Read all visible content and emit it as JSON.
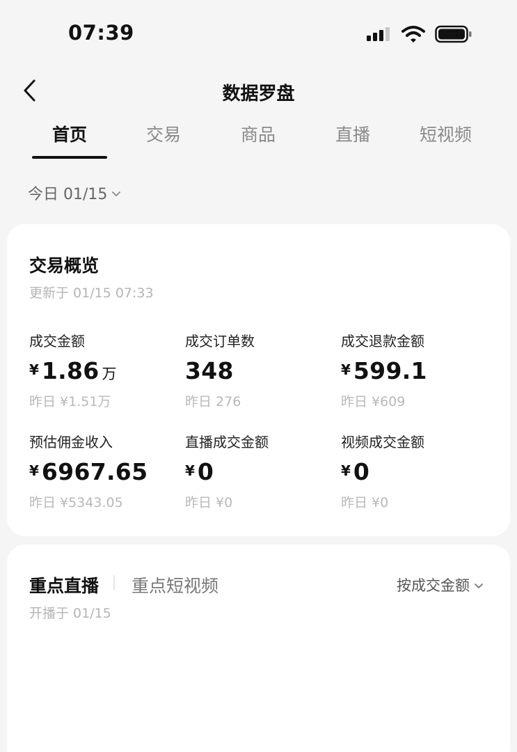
{
  "status_bar": {
    "time": "07:39",
    "icons": [
      "signal-icon",
      "wifi-icon",
      "battery-icon"
    ]
  },
  "nav": {
    "title": "数据罗盘",
    "back_icon": "chevron-left-icon"
  },
  "tabs": [
    {
      "label": "首页",
      "active": true
    },
    {
      "label": "交易",
      "active": false
    },
    {
      "label": "商品",
      "active": false
    },
    {
      "label": "直播",
      "active": false
    },
    {
      "label": "短视频",
      "active": false
    }
  ],
  "date_filter": {
    "label": "今日 01/15",
    "icon": "chevron-down-icon"
  },
  "overview": {
    "title": "交易概览",
    "updated": "更新于 01/15 07:33",
    "metrics": [
      {
        "label": "成交金额",
        "currency": "¥",
        "value": "1.86",
        "unit": "万",
        "previous": "昨日 ¥1.51万"
      },
      {
        "label": "成交订单数",
        "currency": "",
        "value": "348",
        "unit": "",
        "previous": "昨日 276"
      },
      {
        "label": "成交退款金额",
        "currency": "¥",
        "value": "599.1",
        "unit": "",
        "previous": "昨日 ¥609"
      },
      {
        "label": "预估佣金收入",
        "currency": "¥",
        "value": "6967.65",
        "unit": "",
        "previous": "昨日 ¥5343.05"
      },
      {
        "label": "直播成交金额",
        "currency": "¥",
        "value": "0",
        "unit": "",
        "previous": "昨日 ¥0"
      },
      {
        "label": "视频成交金额",
        "currency": "¥",
        "value": "0",
        "unit": "",
        "previous": "昨日 ¥0"
      }
    ]
  },
  "focus": {
    "tab_active": "重点直播",
    "tab_other": "重点短视频",
    "sort_label": "按成交金额",
    "start_text": "开播于 01/15"
  },
  "colors": {
    "background": "#f5f5f5",
    "card": "#ffffff",
    "text_primary": "#111111",
    "text_muted": "#b5b5b5"
  }
}
